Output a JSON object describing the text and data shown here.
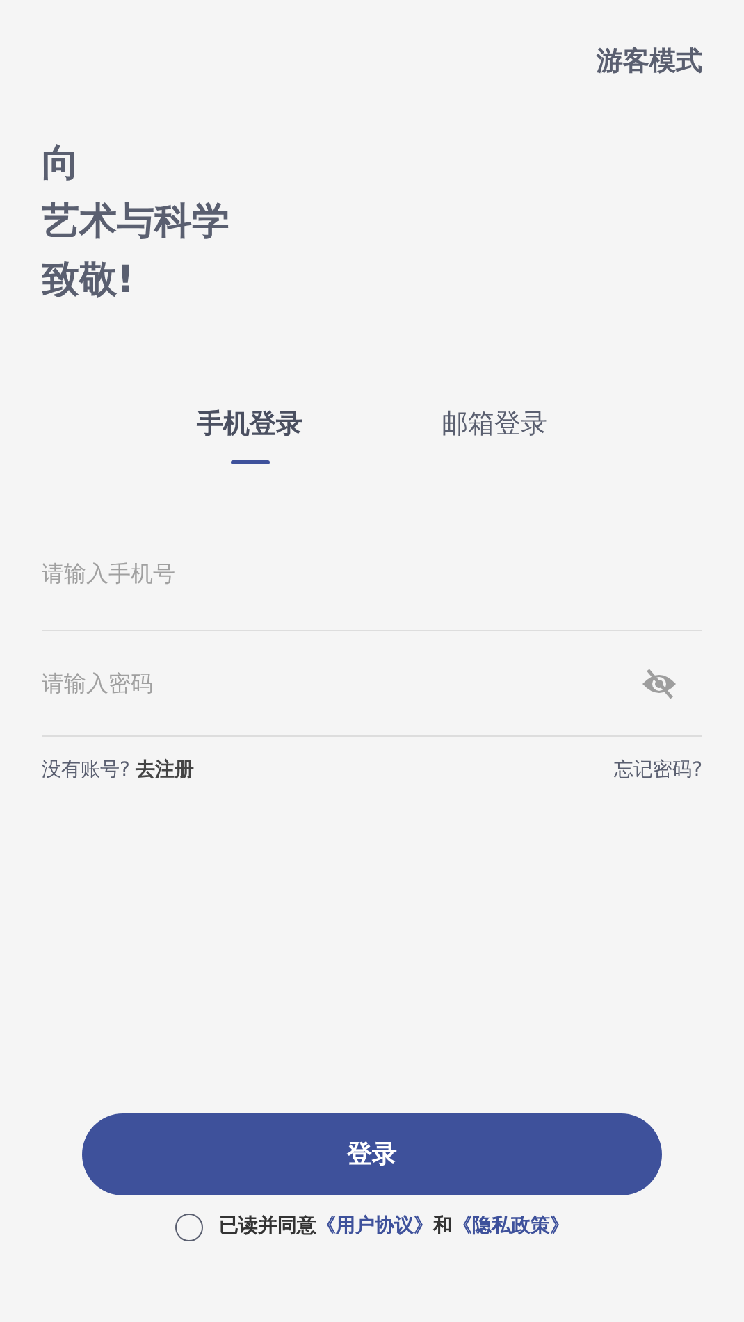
{
  "guest_mode": "游客模式",
  "headline": [
    "向",
    "艺术与科学",
    "致敬!"
  ],
  "tabs": [
    {
      "label": "手机登录",
      "selected": true
    },
    {
      "label": "邮箱登录",
      "selected": false
    }
  ],
  "phone_field": {
    "placeholder": "请输入手机号"
  },
  "password_field": {
    "placeholder": "请输入密码"
  },
  "register": {
    "prompt": "没有账号?",
    "link": "去注册"
  },
  "forgot_password": "忘记密码?",
  "login_button": "登录",
  "agreement": {
    "checked": false,
    "parts": [
      {
        "kind": "text",
        "text": "已读并同意"
      },
      {
        "kind": "link",
        "text": "《用户协议》"
      },
      {
        "kind": "text",
        "text": "和"
      },
      {
        "kind": "link",
        "text": "《隐私政策》"
      }
    ]
  }
}
